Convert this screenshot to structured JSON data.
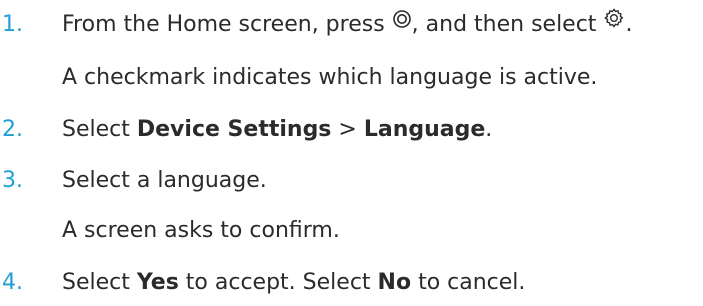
{
  "steps": [
    {
      "number": "1.",
      "text_a": "From the Home screen, press ",
      "icon_a": "circle-button-icon",
      "text_b": ", and then select ",
      "icon_b": "gear-icon",
      "text_c": ".",
      "note": "A checkmark indicates which language is active."
    },
    {
      "number": "2.",
      "text_a": "Select ",
      "bold_a": "Device Settings",
      "text_b": " > ",
      "bold_b": "Language",
      "text_c": "."
    },
    {
      "number": "3.",
      "text_a": "Select a language.",
      "note": "A screen asks to confirm."
    },
    {
      "number": "4.",
      "text_a": "Select ",
      "bold_a": "Yes",
      "text_b": " to accept. Select ",
      "bold_b": "No",
      "text_c": " to cancel."
    }
  ],
  "colors": {
    "number": "#1f9fd6",
    "text": "#2b2b2b"
  }
}
